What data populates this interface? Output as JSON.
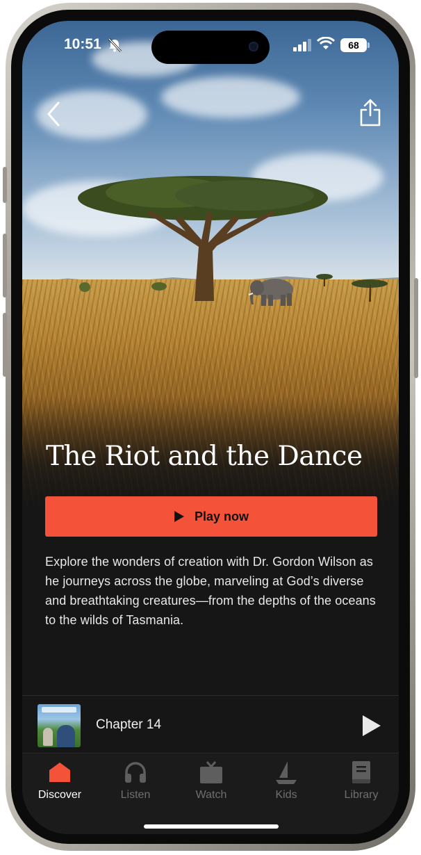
{
  "status_bar": {
    "time": "10:51",
    "battery": "68"
  },
  "header": {
    "back_icon": "chevron-left-icon",
    "share_icon": "share-icon"
  },
  "content": {
    "title": "The Riot and the Dance",
    "play_label": "Play now",
    "description": "Explore the wonders of creation with Dr. Gordon Wilson as he journeys across the globe, marveling at God’s diverse and breathtaking creatures—from the depths of the oceans to the wilds of Tasmania."
  },
  "mini_player": {
    "title": "Chapter 14"
  },
  "tabs": [
    {
      "label": "Discover",
      "icon": "house-icon",
      "active": true
    },
    {
      "label": "Listen",
      "icon": "headphones-icon",
      "active": false
    },
    {
      "label": "Watch",
      "icon": "tv-icon",
      "active": false
    },
    {
      "label": "Kids",
      "icon": "sailboat-icon",
      "active": false
    },
    {
      "label": "Library",
      "icon": "book-icon",
      "active": false
    }
  ],
  "colors": {
    "accent": "#f4533a",
    "background": "#161616",
    "tab_inactive": "#6f6f6f"
  }
}
